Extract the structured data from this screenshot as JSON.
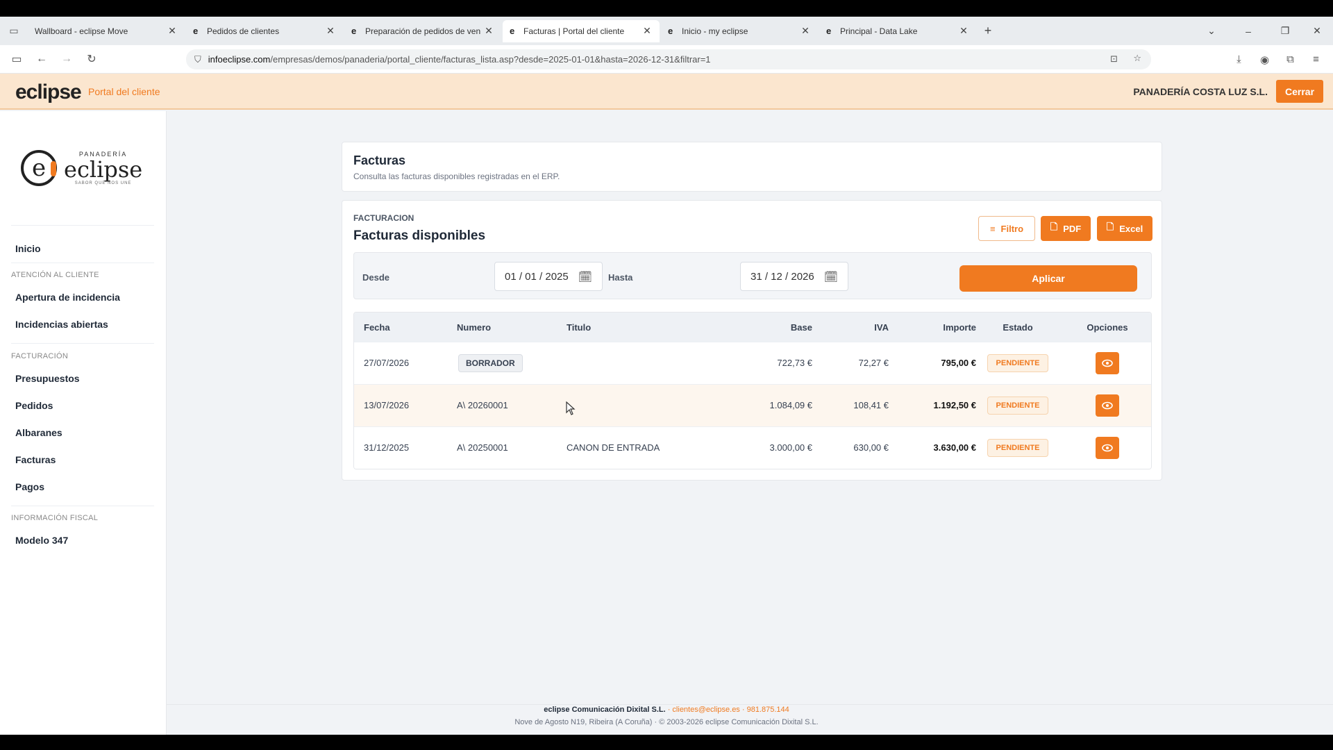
{
  "browser": {
    "tabs": [
      {
        "title": "Wallboard - eclipse Move",
        "active": false
      },
      {
        "title": "Pedidos de clientes",
        "active": false
      },
      {
        "title": "Preparación de pedidos de ven",
        "active": false
      },
      {
        "title": "Facturas | Portal del cliente",
        "active": true
      },
      {
        "title": "Inicio - my eclipse",
        "active": false
      },
      {
        "title": "Principal - Data Lake",
        "active": false
      }
    ],
    "url_host": "infoeclipse.com",
    "url_path": "/empresas/demos/panaderia/portal_cliente/facturas_lista.asp?desde=2025-01-01&hasta=2026-12-31&filtrar=1"
  },
  "header": {
    "brand": "eclipse",
    "portal": "Portal del cliente",
    "company": "PANADERÍA COSTA LUZ S.L.",
    "close_label": "Cerrar"
  },
  "sidebar": {
    "logo": {
      "top": "PANADERÍA",
      "name": "eclipse",
      "tagline": "SABOR QUE NOS UNE"
    },
    "home": "Inicio",
    "sections": [
      {
        "heading": "ATENCIÓN AL CLIENTE",
        "items": [
          "Apertura de incidencia",
          "Incidencias abiertas"
        ]
      },
      {
        "heading": "FACTURACIÓN",
        "items": [
          "Presupuestos",
          "Pedidos",
          "Albaranes",
          "Facturas",
          "Pagos"
        ]
      },
      {
        "heading": "INFORMACIÓN FISCAL",
        "items": [
          "Modelo 347"
        ]
      }
    ]
  },
  "page": {
    "title": "Facturas",
    "subtitle": "Consulta las facturas disponibles registradas en el ERP."
  },
  "invoices": {
    "section_label": "FACTURACION",
    "title": "Facturas disponibles",
    "filter_label": "Filtro",
    "pdf_label": "PDF",
    "excel_label": "Excel",
    "from_label": "Desde",
    "from_value": "01 / 01 / 2025",
    "to_label": "Hasta",
    "to_value": "31 / 12 / 2026",
    "apply_label": "Aplicar",
    "columns": [
      "Fecha",
      "Numero",
      "Titulo",
      "Base",
      "IVA",
      "Importe",
      "Estado",
      "Opciones"
    ],
    "rows": [
      {
        "fecha": "27/07/2026",
        "numero": "BORRADOR",
        "draft": true,
        "titulo": "",
        "base": "722,73 €",
        "iva": "72,27 €",
        "importe": "795,00 €",
        "estado": "PENDIENTE"
      },
      {
        "fecha": "13/07/2026",
        "numero": "A\\ 20260001",
        "draft": false,
        "titulo": "",
        "base": "1.084,09 €",
        "iva": "108,41 €",
        "importe": "1.192,50 €",
        "estado": "PENDIENTE"
      },
      {
        "fecha": "31/12/2025",
        "numero": "A\\ 20250001",
        "draft": false,
        "titulo": "CANON DE ENTRADA",
        "base": "3.000,00 €",
        "iva": "630,00 €",
        "importe": "3.630,00 €",
        "estado": "PENDIENTE"
      }
    ]
  },
  "footer": {
    "company": "eclipse Comunicación Dixital S.L.",
    "contact": " · clientes@eclipse.es · 981.875.144",
    "address": "Nove de Agosto N19, Ribeira (A Coruña) · © 2003-2026 eclipse Comunicación Dixital S.L."
  },
  "colors": {
    "accent": "#f07a20",
    "header_bg": "#fbe6cf"
  }
}
